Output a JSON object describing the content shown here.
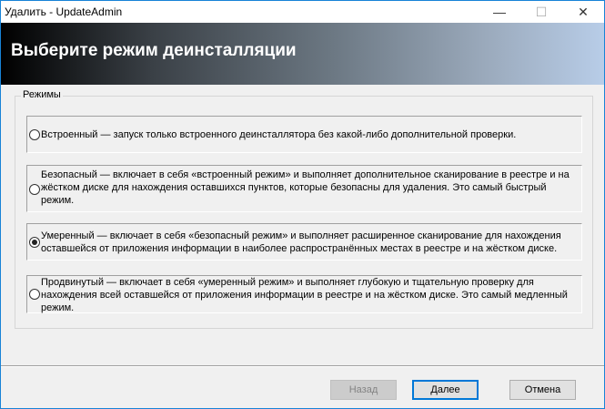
{
  "window": {
    "title": "Удалить - UpdateAdmin",
    "minimize": "—",
    "maximize": "☐",
    "close": "✕"
  },
  "banner": {
    "heading": "Выберите режим деинсталляции"
  },
  "modes": {
    "legend": "Режимы",
    "options": [
      {
        "label": "Встроенный — запуск только встроенного деинсталлятора без какой-либо дополнительной проверки.",
        "selected": false
      },
      {
        "label": "Безопасный — включает в себя «встроенный режим» и выполняет дополнительное сканирование в реестре и на жёстком диске для нахождения оставшихся пунктов, которые безопасны для удаления. Это самый быстрый режим.",
        "selected": false
      },
      {
        "label": "Умеренный — включает в себя «безопасный режим» и выполняет расширенное сканирование для нахождения оставшейся от приложения информации в наиболее распространённых местах в реестре и на жёстком диске.",
        "selected": true
      },
      {
        "label": "Продвинутый — включает в себя «умеренный режим» и выполняет глубокую и тщательную проверку для нахождения всей оставшейся от приложения информации в реестре и на жёстком диске. Это самый медленный режим.",
        "selected": false
      }
    ]
  },
  "buttons": {
    "back": "Назад",
    "next": "Далее",
    "cancel": "Отмена"
  }
}
